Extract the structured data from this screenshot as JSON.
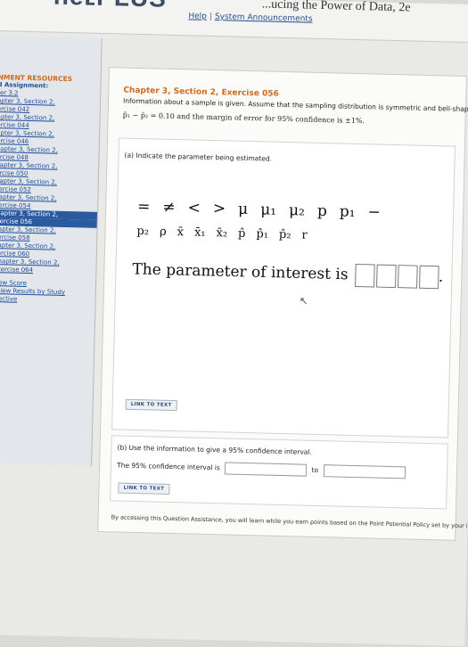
{
  "header": {
    "brand": "neʟPLUS",
    "book_title": "...ucing the Power of Data, 2e",
    "help_link": "Help",
    "separator": "|",
    "announcements_link": "System Announcements"
  },
  "sidebar": {
    "heading": "NMENT RESOURCES",
    "assignment_label": "d Assignment:",
    "items": [
      "ter 3.2",
      "apter 3, Section 2,",
      "ercise 042",
      "apter 3, Section 2,",
      "ercise 044",
      "apter 3, Section 2,",
      "ercise 046",
      "napter 3, Section 2,",
      "ercise 048",
      "hapter 3, Section 2,",
      "ercise 050",
      "hapter 3, Section 2,",
      "xercise 052",
      "hapter 3, Section 2,",
      "xercise 054",
      "hapter 3, Section 2,",
      "xercise 056",
      "hapter 3, Section 2,",
      "xercise 058",
      "hapter 3, Section 2,",
      "xercise 060",
      "Chapter 3, Section 2,",
      "Exercise 064"
    ],
    "active_items": [
      15,
      16
    ],
    "review_score": "view Score",
    "review_results": "eview Results by Study",
    "objective": "bjective"
  },
  "exercise": {
    "title": "Chapter 3, Section 2, Exercise 056",
    "intro": "Information about a sample is given. Assume that the sampling distribution is symmetric and bell-shaped.",
    "given": "p̂₁ − p̂₂ = 0.10 and the margin of error for 95% confidence is ±1%."
  },
  "part_a": {
    "label": "(a) Indicate the parameter being estimated.",
    "symbols_row1": [
      "=",
      "≠",
      "<",
      ">",
      "μ",
      "μ₁",
      "μ₂",
      "p",
      "p₁",
      "−"
    ],
    "symbols_row2": [
      "p₂",
      "ρ",
      "x̄",
      "x̄₁",
      "x̄₂",
      "p̂",
      "p̂₁",
      "p̂₂",
      "r"
    ],
    "answer_prefix": "The parameter of interest is",
    "answer_suffix": ".",
    "link_text": "LINK TO TEXT"
  },
  "part_b": {
    "label": "(b) Use the information to give a 95% confidence interval.",
    "ci_prefix": "The 95% confidence interval is",
    "ci_to": "to",
    "link_text": "LINK TO TEXT"
  },
  "footer": {
    "note": "By accessing this Question Assistance, you will learn while you earn points based on the Point Potential Policy set by your instructor."
  }
}
